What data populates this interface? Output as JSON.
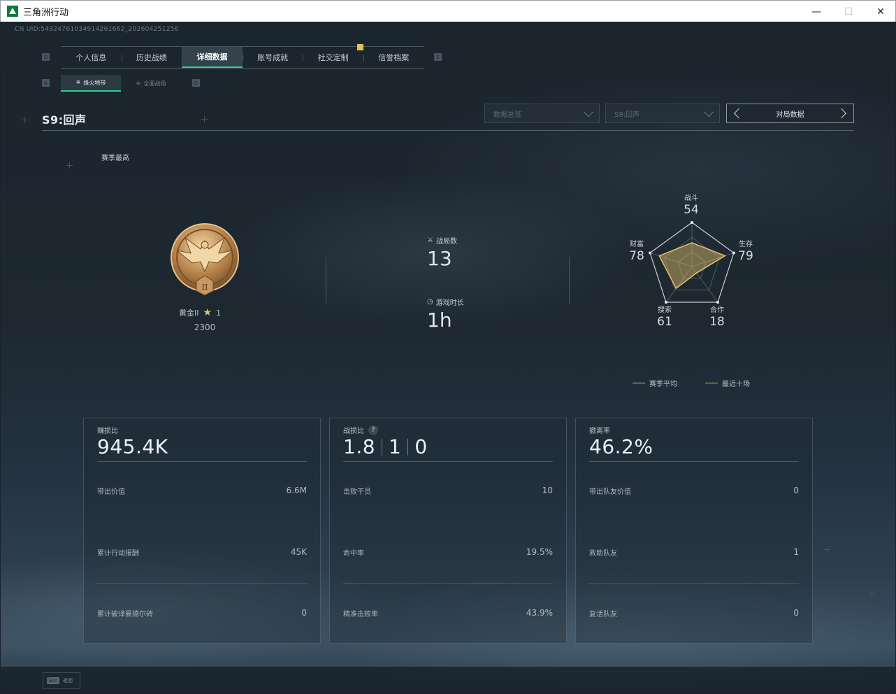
{
  "window": {
    "title": "三角洲行动",
    "minimize": "—",
    "maximize": "☐",
    "close": "✕"
  },
  "uid": "CN UID:5492476103491426166​2_202604251256",
  "keys": {
    "q": "Q",
    "e": "E",
    "a": "A",
    "d": "D"
  },
  "tabs": [
    {
      "label": "个人信息"
    },
    {
      "label": "历史战绩"
    },
    {
      "label": "详细数据",
      "active": true
    },
    {
      "label": "账号成就"
    },
    {
      "label": "社交定制"
    },
    {
      "label": "信誉档案"
    }
  ],
  "subtabs": [
    {
      "label": "烽火地带",
      "active": true,
      "icon": "operations-icon"
    },
    {
      "label": "全面战场",
      "icon": "warfare-icon"
    }
  ],
  "season_title": "S9:回声",
  "filters": {
    "data_type": "数据总览",
    "season": "S9:回声",
    "pager_label": "对局数据"
  },
  "season_best_label": "赛季最高",
  "rank": {
    "name": "黄金II",
    "stars": "1",
    "score": "2300",
    "emblem_numeral": "II"
  },
  "matches": {
    "label": "战局数",
    "value": "13",
    "icon": "crossed-swords-icon"
  },
  "playtime": {
    "label": "游戏时长",
    "value": "1h",
    "icon": "clock-icon"
  },
  "radar": {
    "axes": [
      {
        "label": "战斗",
        "value": "54",
        "key": "combat",
        "score": 54
      },
      {
        "label": "生存",
        "value": "79",
        "key": "survival",
        "score": 79
      },
      {
        "label": "合作",
        "value": "18",
        "key": "teamwork",
        "score": 18
      },
      {
        "label": "搜索",
        "value": "61",
        "key": "search",
        "score": 61
      },
      {
        "label": "财富",
        "value": "78",
        "key": "wealth",
        "score": 78
      }
    ],
    "season_avg_color": "#c9d1d6",
    "recent_color": "#e3c06a"
  },
  "legend": {
    "season_avg": "赛季平均",
    "recent": "最近十场"
  },
  "cards": [
    {
      "title": "赚损比",
      "big": "945.4K",
      "rows": [
        {
          "label": "带出价值",
          "value": "6.6M"
        },
        {
          "label": "累计行动报酬",
          "value": "45K"
        },
        {
          "label": "累计破译曼德尔砖",
          "value": "0"
        }
      ]
    },
    {
      "title": "战损比",
      "big_parts": [
        "1.8",
        "1",
        "0"
      ],
      "help": "?",
      "rows": [
        {
          "label": "击败干员",
          "value": "10"
        },
        {
          "label": "命中率",
          "value": "19.5%"
        },
        {
          "label": "精准击败率",
          "value": "43.9%"
        }
      ]
    },
    {
      "title": "撤离率",
      "big": "46.2%",
      "rows": [
        {
          "label": "带出队友价值",
          "value": "0"
        },
        {
          "label": "救助队友",
          "value": "1"
        },
        {
          "label": "复活队友",
          "value": "0"
        }
      ]
    }
  ],
  "footer": {
    "esc_key": "Esc",
    "back_label": "返回"
  }
}
